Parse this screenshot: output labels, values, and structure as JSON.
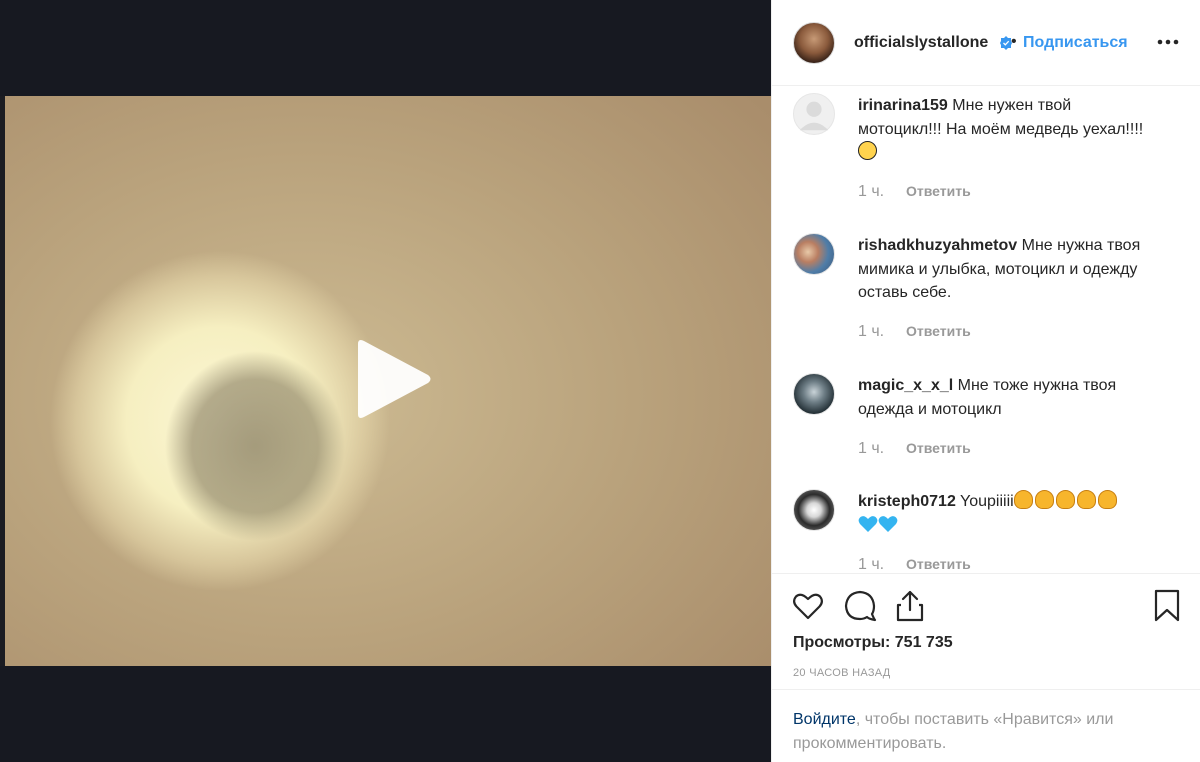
{
  "header": {
    "username": "officialslystallone",
    "separator": "•",
    "follow_label": "Подписаться",
    "verified_icon": "verified-badge-icon",
    "more_icon": "ellipsis-icon"
  },
  "media": {
    "type": "video",
    "play_icon": "play-icon"
  },
  "comments": [
    {
      "username": "irinarina159",
      "text": "Мне нужен твой мотоцикл!!! На моём медведь уехал!!!!",
      "emoji": [
        "grinning-face-icon"
      ],
      "time": "1 ч.",
      "reply_label": "Ответить"
    },
    {
      "username": "rishadkhuzyahmetov",
      "text": "Мне нужна твоя мимика и улыбка, мотоцикл и одежду оставь себе.",
      "time": "1 ч.",
      "reply_label": "Ответить"
    },
    {
      "username": "magic_x_x_l",
      "text": "Мне тоже нужна твоя одежда и мотоцикл",
      "time": "1 ч.",
      "reply_label": "Ответить"
    },
    {
      "username": "kristeph0712",
      "text": "Youpiiiii",
      "emoji": [
        "clapping-hands-icon",
        "clapping-hands-icon",
        "clapping-hands-icon",
        "clapping-hands-icon",
        "clapping-hands-icon",
        "blue-heart-icon",
        "blue-heart-icon"
      ],
      "time": "1 ч.",
      "reply_label": "Ответить"
    }
  ],
  "actions": {
    "like_icon": "heart-icon",
    "comment_icon": "comment-icon",
    "share_icon": "share-icon",
    "save_icon": "bookmark-icon",
    "views_label": "Просмотры: 751 735",
    "timestamp": "20 ЧАСОВ НАЗАД"
  },
  "login_prompt": {
    "link_text": "Войдите",
    "rest_text": ", чтобы поставить «Нравится» или прокомментировать."
  },
  "colors": {
    "accent": "#3897f0",
    "link_dark": "#003569",
    "muted": "#999999",
    "text": "#262626",
    "media_bg": "#171921"
  }
}
